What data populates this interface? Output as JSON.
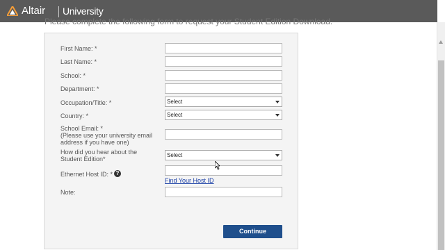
{
  "header": {
    "brand": "Altair",
    "sub": "University",
    "icon": "altair-logo-icon",
    "bg_color": "#5a5a5a"
  },
  "intro_text": "Please complete the following form to request your Student Edition Download.",
  "form": {
    "first_name_label": "First Name: *",
    "last_name_label": "Last Name: *",
    "school_label": "School: *",
    "department_label": "Department: *",
    "occupation_label": "Occupation/Title: *",
    "occupation_value": "Select",
    "country_label": "Country: *",
    "country_value": "Select",
    "school_email_label_1": "School Email: *",
    "school_email_label_2": "(Please use your university email",
    "school_email_label_3": "address if you have one)",
    "hear_label_1": "How did you hear about the",
    "hear_label_2": "Student Edition*",
    "hear_value": "Select",
    "host_id_label": "Ethernet Host ID: *",
    "host_help_icon": "?",
    "find_host_link": "Find Your Host ID",
    "note_label": "Note:",
    "continue_label": "Continue",
    "button_color": "#1f4f8c"
  }
}
